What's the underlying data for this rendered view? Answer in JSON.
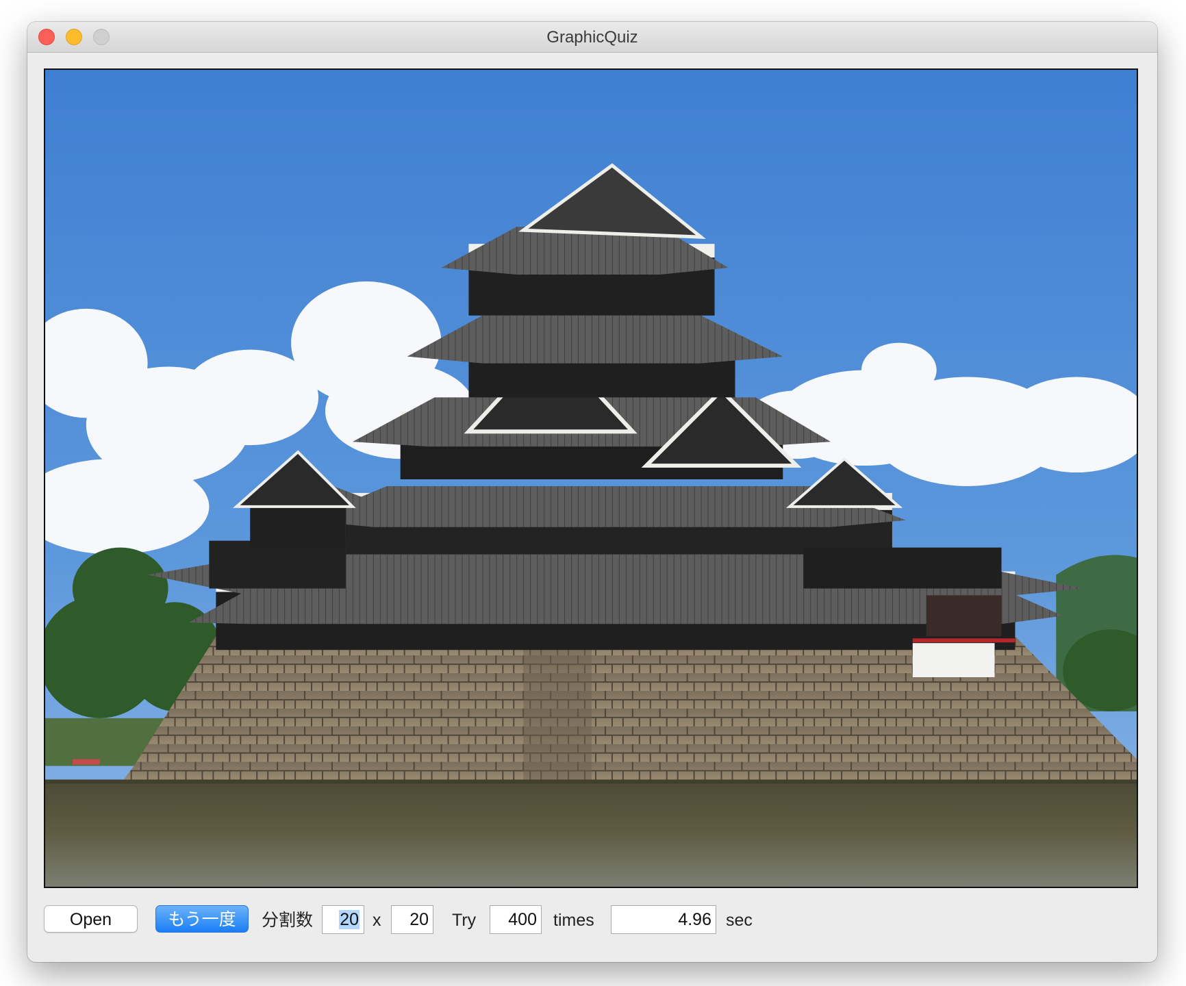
{
  "window": {
    "title": "GraphicQuiz"
  },
  "controls": {
    "open_label": "Open",
    "retry_label": "もう一度",
    "divisions_label": "分割数",
    "divisions_cols": "20",
    "times_symbol": "x",
    "divisions_rows": "20",
    "try_label": "Try",
    "try_count": "400",
    "times_label": "times",
    "elapsed": "4.96",
    "sec_label": "sec"
  },
  "icons": {
    "close": "close-icon",
    "minimize": "minimize-icon",
    "zoom": "zoom-icon"
  },
  "colors": {
    "accent": "#1a7ef5",
    "selection": "#b2d7ff",
    "close": "#fc5f57",
    "minimize": "#fdbc2e",
    "zoom_disabled": "#cfcfcf"
  }
}
